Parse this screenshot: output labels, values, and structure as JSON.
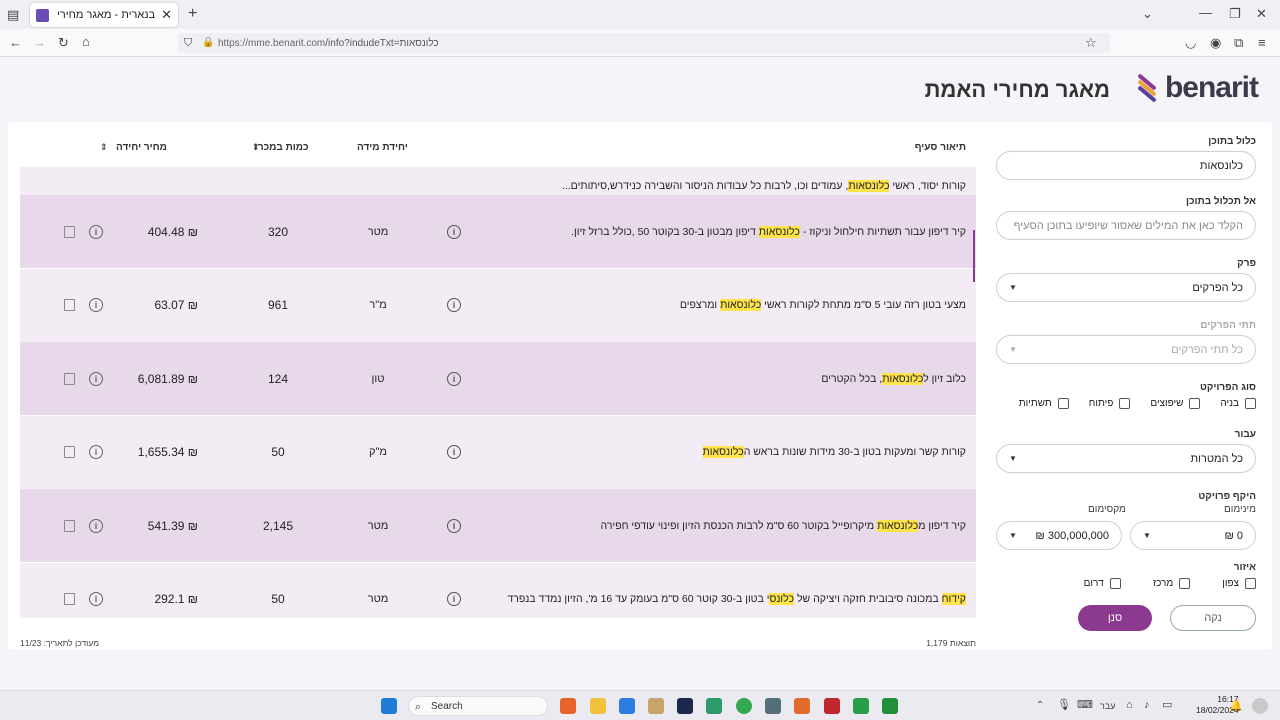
{
  "browser": {
    "tab_title": "בנארית - מאגר מחירי האמת",
    "url_host": "https://mme.benarit.com",
    "url_path": "/info?indudeTxt=כלונסאות"
  },
  "brand": {
    "logo_word": "benarit",
    "headline": "מאגר מחירי האמת",
    "colors": {
      "accent": "#8b3a8f",
      "highlight": "#ffe34a"
    }
  },
  "filters": {
    "include_label": "כלול בתוכן",
    "include_value": "כלונסאות",
    "exclude_label": "אל תכלול בתוכן",
    "exclude_placeholder": "הקלד כאן את המילים שאסור שיופיעו בתוכן הסעיף",
    "chapter_label": "פרק",
    "chapter_value": "כל הפרקים",
    "subchapter_label": "תתי הפרקים",
    "subchapter_value": "כל תתי הפרקים",
    "project_type_label": "סוג הפרויקט",
    "project_types": [
      "בניה",
      "שיפוצים",
      "פיתוח",
      "תשתיות"
    ],
    "for_label": "עבור",
    "for_value": "כל המטרות",
    "scope_label": "היקף פרויקט",
    "min_label": "מינימום",
    "max_label": "מקסימום",
    "min_value": "0 ₪",
    "max_value": "300,000,000 ₪",
    "region_label": "איזור",
    "regions": [
      "צפון",
      "מרכז",
      "דרום"
    ],
    "filter_button": "סנן",
    "clear_button": "נקה"
  },
  "table": {
    "headers": {
      "desc": "תיאור סעיף",
      "unit": "יחידת מידה",
      "qty": "כמות במכרז",
      "price": "מחיר יחידה"
    },
    "top_partial": "קורות יסוד, ראשי כלונסאות, עמודים וכו, לרבות כל עבודות הניסור והשבירה כנידרש,סיתותים...",
    "rows": [
      {
        "desc": "קיר דיפון עבור תשתיות חילחול וניקוז - כלונסאות דיפון מבטון ב-30 בקוטר 50 ,כולל ברזל זיון.",
        "unit": "מטר",
        "qty": "320",
        "price": "404.48 ₪"
      },
      {
        "desc": "מצעי בטון רזה עובי 5 ס\"מ מתחת לקורות ראשי כלונסאות ומרצפים",
        "unit": "מ\"ר",
        "qty": "961",
        "price": "63.07 ₪"
      },
      {
        "desc": "כלוב זיון לכלונסאות, בכל הקטרים",
        "unit": "טון",
        "qty": "124",
        "price": "6,081.89 ₪"
      },
      {
        "desc": "קורות קשר ומעקות בטון ב-30 מידות שונות בראש הכלונסאות",
        "unit": "מ\"ק",
        "qty": "50",
        "price": "1,655.34 ₪"
      },
      {
        "desc": "קיר דיפון מכלונסאות מיקרופייל בקוטר 60 ס\"מ לרבות הכנסת הזיון ופינוי עודפי חפירה",
        "unit": "מטר",
        "qty": "2,145",
        "price": "541.39 ₪"
      },
      {
        "desc": "קידוח במכונה סיבובית חזקה ויציקה של כלונסי בטון ב-30 קוטר 60 ס\"מ בעומק עד 16 מ', הזיון נמדד בנפרד",
        "unit": "מטר",
        "qty": "50",
        "price": "292.1 ₪"
      }
    ],
    "results_count": "1,179 תוצאות",
    "updated": "מעודכן לתאריך: 11/23"
  },
  "taskbar": {
    "search": "Search",
    "lang": "עבר",
    "time": "16:17",
    "date": "18/02/2024"
  }
}
